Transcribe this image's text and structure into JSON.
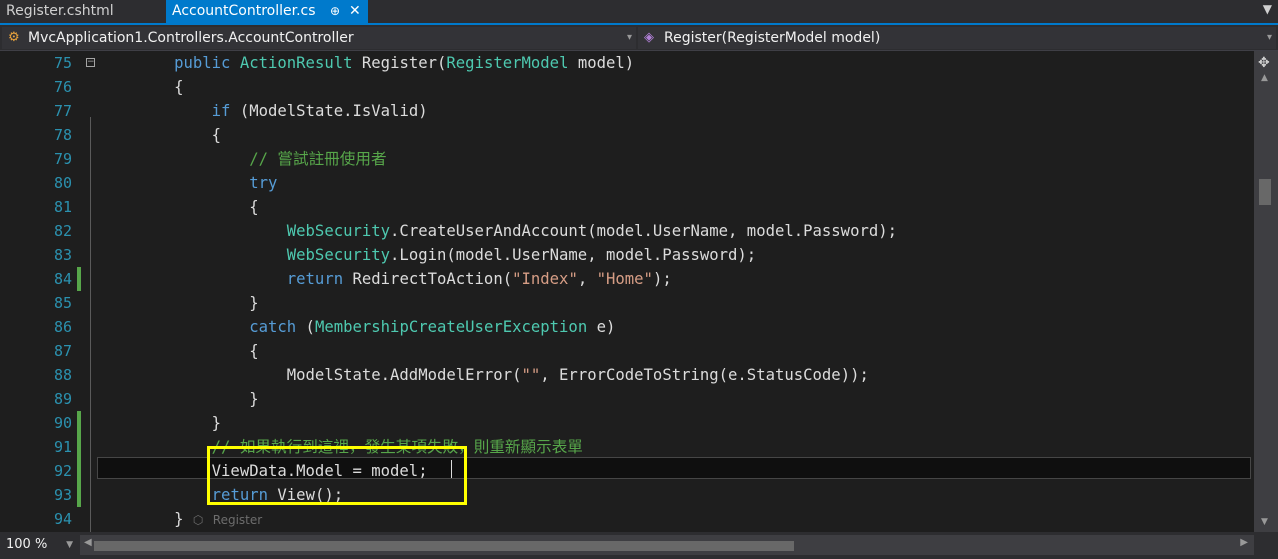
{
  "tabs": [
    {
      "label": "Register.cshtml",
      "active": false
    },
    {
      "label": "AccountController.cs",
      "active": true
    }
  ],
  "tab_pin_glyph": "⊕",
  "tab_close_glyph": "✕",
  "tab_dropdown_glyph": "▼",
  "nav": {
    "left_label": "MvcApplication1.Controllers.AccountController",
    "left_icon": "class-icon",
    "right_label": "Register(RegisterModel model)",
    "right_icon": "method-icon",
    "arrow": "▾"
  },
  "line_numbers": [
    "75",
    "76",
    "77",
    "78",
    "79",
    "80",
    "81",
    "82",
    "83",
    "84",
    "85",
    "86",
    "87",
    "88",
    "89",
    "90",
    "91",
    "92",
    "93",
    "94"
  ],
  "modified_lines": [
    84,
    90,
    91,
    92,
    93
  ],
  "code_lens": "Register",
  "fold_glyph": "−",
  "zoom": "100 %",
  "colors": {
    "accent": "#007acc",
    "highlight_box": "#ffff00",
    "keyword": "#569cd6",
    "type": "#4ec9b0",
    "string": "#d69d85",
    "comment": "#57a64a",
    "line_number": "#2b91af"
  }
}
